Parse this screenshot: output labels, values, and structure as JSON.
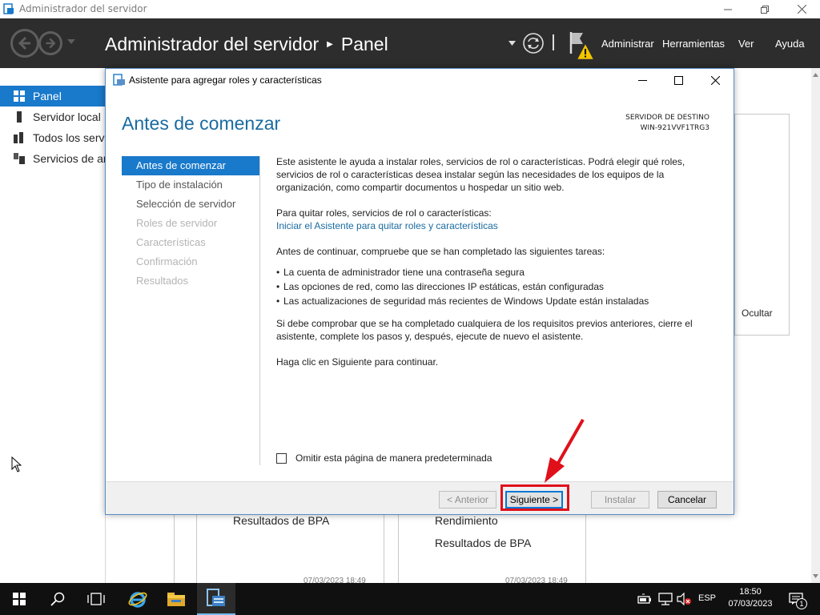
{
  "window": {
    "title": "Administrador del servidor"
  },
  "header": {
    "breadcrumb_app": "Administrador del servidor",
    "breadcrumb_page": "Panel",
    "menu": [
      "Administrar",
      "Herramientas",
      "Ver",
      "Ayuda"
    ]
  },
  "sidebar": {
    "items": [
      {
        "label": "Panel",
        "active": true,
        "icon": "dashboard-icon"
      },
      {
        "label": "Servidor local",
        "active": false,
        "icon": "server-icon"
      },
      {
        "label": "Todos los servidores",
        "active": false,
        "icon": "servers-icon"
      },
      {
        "label": "Servicios de archivos y de almacenamiento",
        "active": false,
        "icon": "storage-icon"
      }
    ]
  },
  "background": {
    "hide_label": "Ocultar",
    "tile_left": {
      "rows": [
        "Resultados de BPA"
      ],
      "timestamp": "07/03/2023 18:49"
    },
    "tile_right": {
      "rows": [
        "Rendimiento",
        "Resultados de BPA"
      ],
      "timestamp": "07/03/2023 18:49"
    }
  },
  "dialog": {
    "title": "Asistente para agregar roles y características",
    "heading": "Antes de comenzar",
    "destination_label": "SERVIDOR DE DESTINO",
    "destination_server": "WIN-921VVF1TRG3",
    "steps": [
      {
        "label": "Antes de comenzar",
        "state": "active"
      },
      {
        "label": "Tipo de instalación",
        "state": "enabled"
      },
      {
        "label": "Selección de servidor",
        "state": "enabled"
      },
      {
        "label": "Roles de servidor",
        "state": "disabled"
      },
      {
        "label": "Características",
        "state": "disabled"
      },
      {
        "label": "Confirmación",
        "state": "disabled"
      },
      {
        "label": "Resultados",
        "state": "disabled"
      }
    ],
    "intro": "Este asistente le ayuda a instalar roles, servicios de rol o características. Podrá elegir qué roles, servicios de rol o características desea instalar según las necesidades de los equipos de la organización, como compartir documentos u hospedar un sitio web.",
    "remove_label": "Para quitar roles, servicios de rol o características:",
    "remove_link": "Iniciar el Asistente para quitar roles y características",
    "before_continue": "Antes de continuar, compruebe que se han completado las siguientes tareas:",
    "tasks": [
      "La cuenta de administrador tiene una contraseña segura",
      "Las opciones de red, como las direcciones IP estáticas, están configuradas",
      "Las actualizaciones de seguridad más recientes de Windows Update están instaladas"
    ],
    "prereq_note": "Si debe comprobar que se ha completado cualquiera de los requisitos previos anteriores, cierre el asistente, complete los pasos y, después, ejecute de nuevo el asistente.",
    "click_next": "Haga clic en Siguiente para continuar.",
    "skip_checkbox_label": "Omitir esta página de manera predeterminada",
    "skip_checked": false,
    "buttons": {
      "previous": "< Anterior",
      "next": "Siguiente >",
      "install": "Instalar",
      "cancel": "Cancelar"
    }
  },
  "annotation": {
    "highlight_color": "#e0101a"
  },
  "taskbar": {
    "language": "ESP",
    "time": "18:50",
    "date": "07/03/2023",
    "notification_count": "1"
  },
  "colors": {
    "accent": "#1979ca",
    "header_bg": "#2d2d2d",
    "heading_blue": "#1a6ba0"
  }
}
